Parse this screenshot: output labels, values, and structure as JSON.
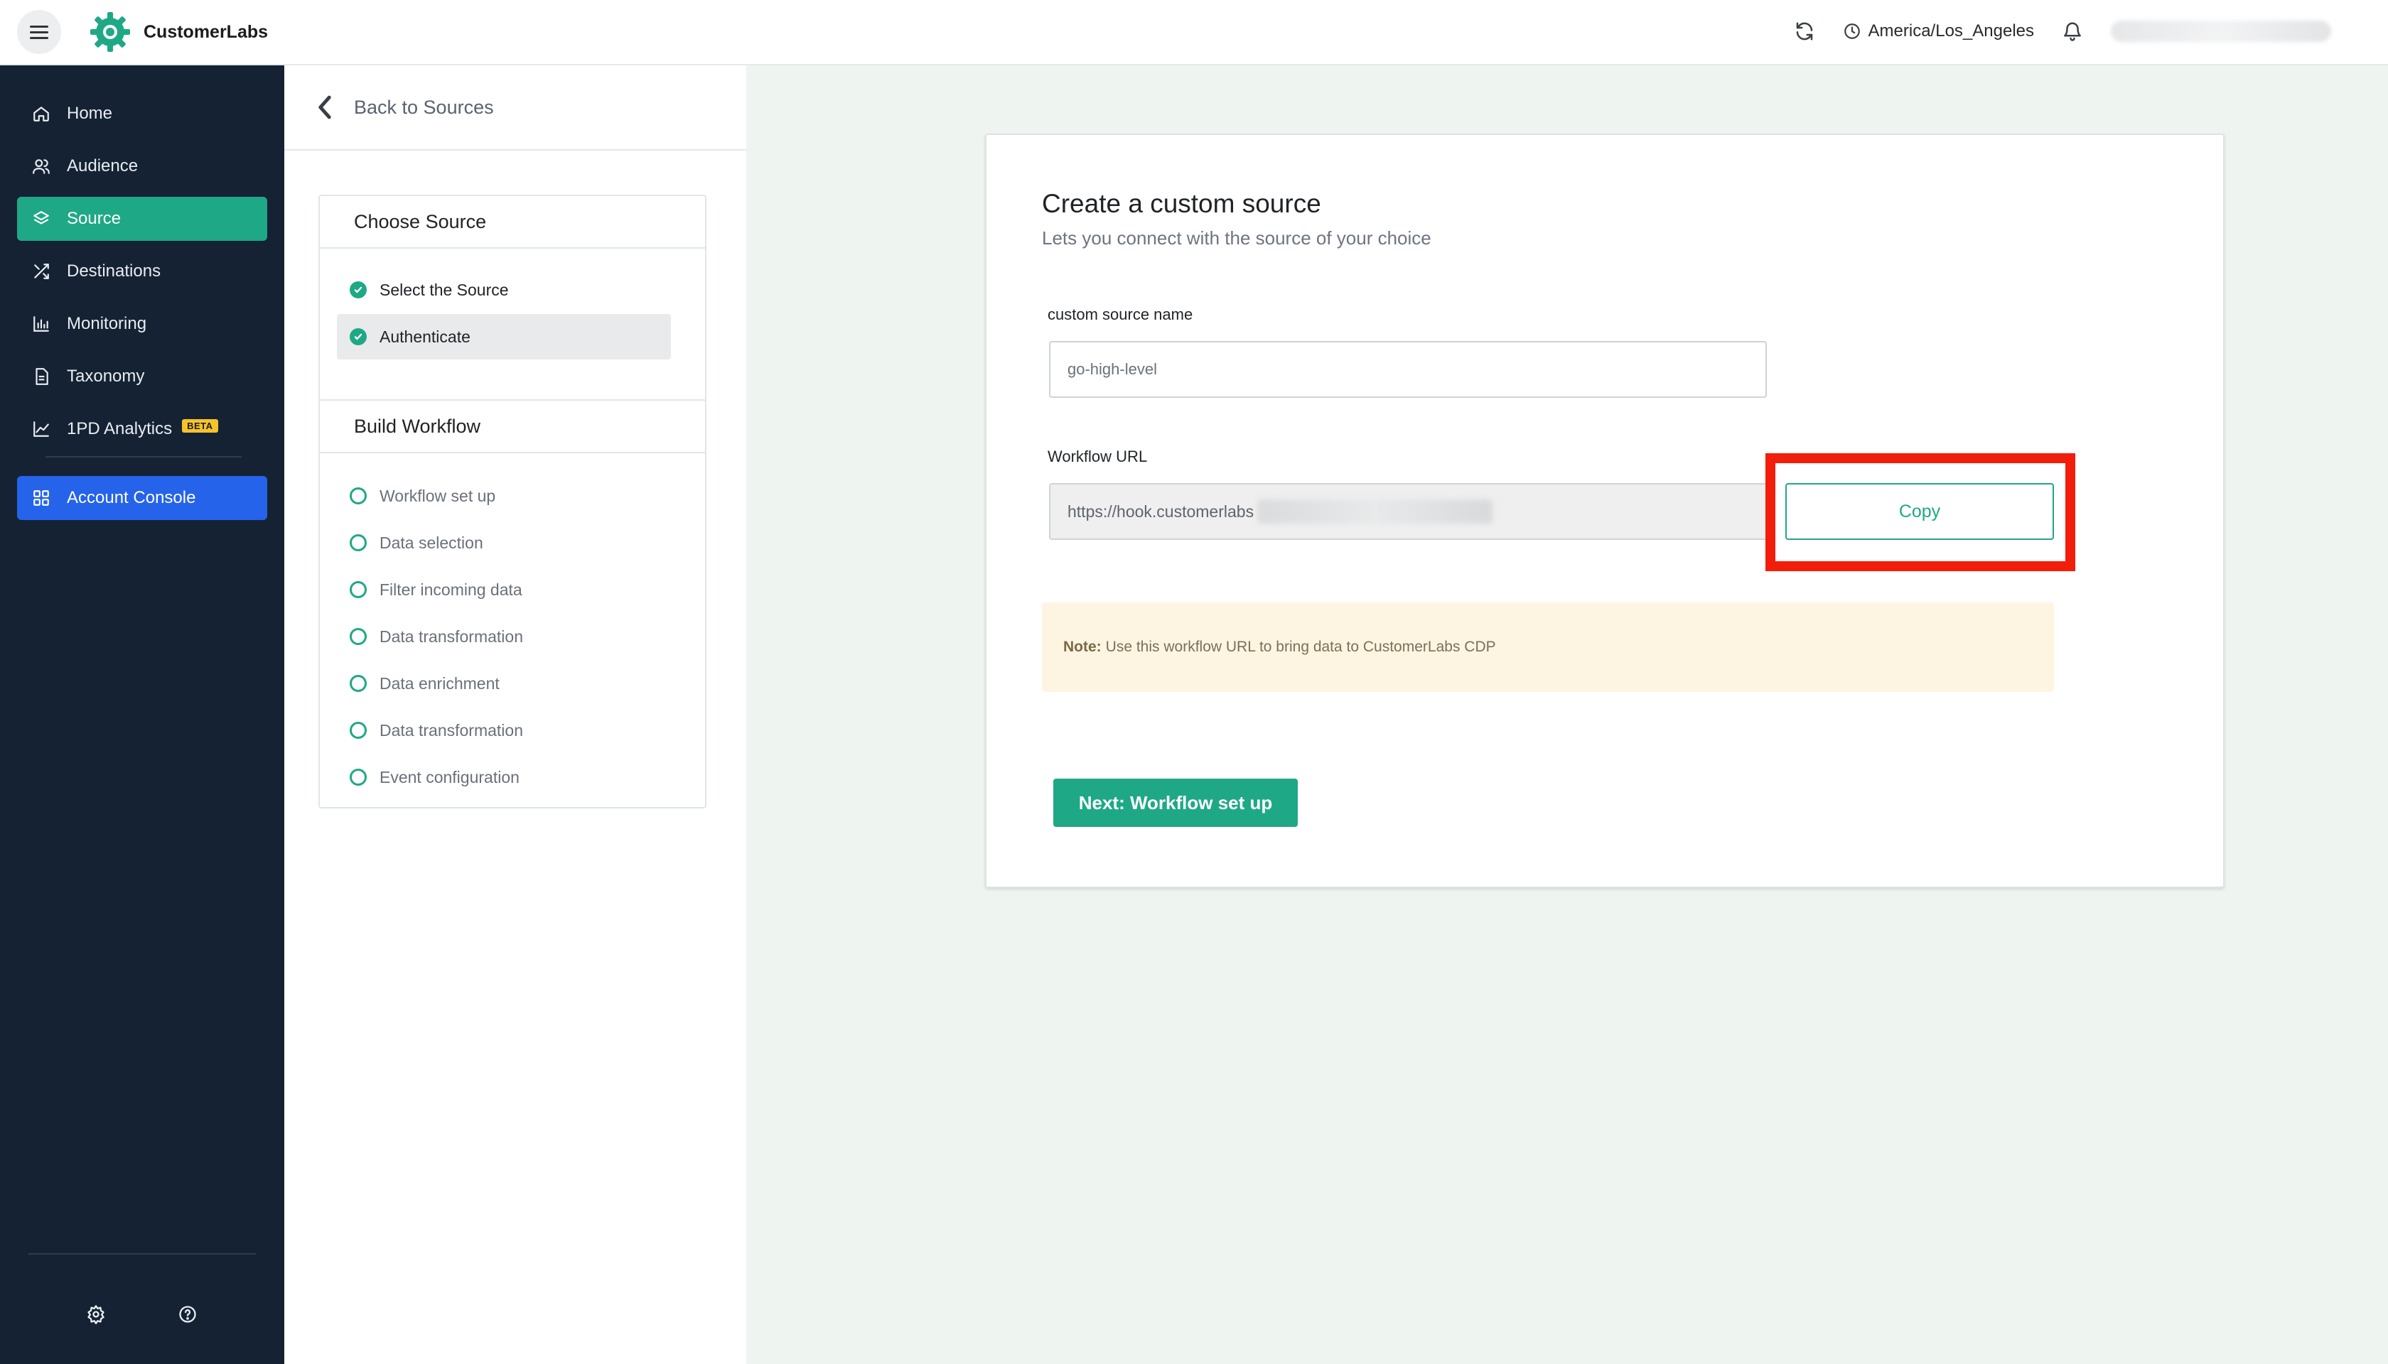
{
  "app": {
    "brand_name": "CustomerLabs",
    "accent_color": "#1fa886",
    "sidebar_color": "#152233"
  },
  "topbar": {
    "timezone": "America/Los_Angeles",
    "icons": [
      "menu-icon",
      "refresh-icon",
      "clock-icon",
      "bell-icon"
    ]
  },
  "sidebar": {
    "items": [
      {
        "label": "Home",
        "icon": "home-icon"
      },
      {
        "label": "Audience",
        "icon": "users-icon"
      },
      {
        "label": "Source",
        "icon": "layers-icon",
        "active": true
      },
      {
        "label": "Destinations",
        "icon": "shuffle-icon"
      },
      {
        "label": "Monitoring",
        "icon": "chart-icon"
      },
      {
        "label": "Taxonomy",
        "icon": "document-icon"
      },
      {
        "label": "1PD Analytics",
        "icon": "trend-icon",
        "badge": "BETA"
      },
      {
        "label": "Account Console",
        "icon": "grid-icon"
      }
    ],
    "bottom_icons": [
      "settings-icon",
      "help-icon"
    ]
  },
  "steps_panel": {
    "back_label": "Back to Sources",
    "choose_source": {
      "title": "Choose Source",
      "steps": [
        {
          "label": "Select the Source",
          "status": "done"
        },
        {
          "label": "Authenticate",
          "status": "done",
          "current": true
        }
      ]
    },
    "build_workflow": {
      "title": "Build Workflow",
      "steps": [
        {
          "label": "Workflow set up",
          "status": "pending"
        },
        {
          "label": "Data selection",
          "status": "pending"
        },
        {
          "label": "Filter incoming data",
          "status": "pending"
        },
        {
          "label": "Data transformation",
          "status": "pending"
        },
        {
          "label": "Data enrichment",
          "status": "pending"
        },
        {
          "label": "Data transformation",
          "status": "pending"
        },
        {
          "label": "Event configuration",
          "status": "pending"
        }
      ]
    }
  },
  "form": {
    "title": "Create a custom source",
    "subtitle": "Lets you connect with the source of your choice",
    "name_label": "custom source name",
    "name_value": "go-high-level",
    "url_label": "Workflow URL",
    "url_value": "https://hook.customerlabs",
    "copy_label": "Copy",
    "note_prefix": "Note:",
    "note_text": "Use this workflow URL to bring data to CustomerLabs CDP",
    "next_label": "Next: Workflow set up"
  }
}
